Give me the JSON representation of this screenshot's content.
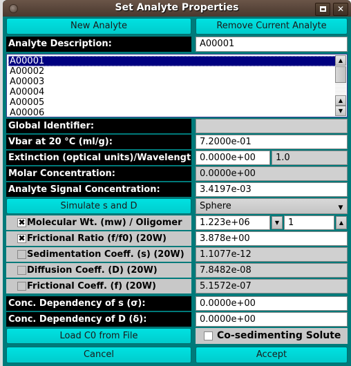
{
  "window": {
    "title": "Set Analyte Properties",
    "maximize_icon": "maximize-icon",
    "close_icon": "close-icon",
    "close_glyph": "✕"
  },
  "buttons": {
    "new_analyte": "New Analyte",
    "remove_analyte": "Remove Current Analyte",
    "simulate": "Simulate s and D",
    "load_c0": "Load C0 from File",
    "cancel": "Cancel",
    "accept": "Accept"
  },
  "analyte_description": {
    "label": "Analyte Description:",
    "value": "A00001"
  },
  "analyte_list": {
    "items": [
      "A00001",
      "A00002",
      "A00003",
      "A00004",
      "A00005",
      "A00006"
    ],
    "selected": "A00001",
    "scroll_up_glyph": "▲",
    "scroll_down_glyph": "▼"
  },
  "fields": {
    "global_identifier": {
      "label": "Global Identifier:",
      "value": ""
    },
    "vbar": {
      "label": "Vbar at 20 °C (ml/g):",
      "value": "7.2000e-01"
    },
    "extinction": {
      "label": "Extinction (optical units)/Wavelength:",
      "value": "0.0000e+00",
      "wavelength": "1.0"
    },
    "molar_conc": {
      "label": "Molar Concentration:",
      "value": "0.0000e+00"
    },
    "signal_conc": {
      "label": "Analyte Signal Concentration:",
      "value": "3.4197e-03"
    }
  },
  "shape_select": {
    "value": "Sphere",
    "arrow": "▼"
  },
  "hydro": {
    "mw": {
      "label": "Molecular Wt. (mw) / Oligomer",
      "checked": true,
      "value": "1.223e+06",
      "oligomer": "1"
    },
    "ff0": {
      "label": "Frictional Ratio (f/f0) (20W)",
      "checked": true,
      "value": "3.878e+00"
    },
    "sed": {
      "label": "Sedimentation Coeff. (s) (20W)",
      "checked": false,
      "value": "1.1077e-12"
    },
    "diff": {
      "label": "Diffusion Coeff. (D) (20W)",
      "checked": false,
      "value": "7.8482e-08"
    },
    "fric": {
      "label": "Frictional Coeff. (f) (20W)",
      "checked": false,
      "value": "5.1572e-07"
    }
  },
  "conc_dep": {
    "sigma": {
      "label": "Conc. Dependency of s (σ):",
      "value": "0.0000e+00"
    },
    "delta": {
      "label": "Conc. Dependency of D (δ):",
      "value": "0.0000e+00"
    }
  },
  "cosed": {
    "label": "Co-sedimenting Solute",
    "checked": false
  },
  "check_glyph": "✖"
}
